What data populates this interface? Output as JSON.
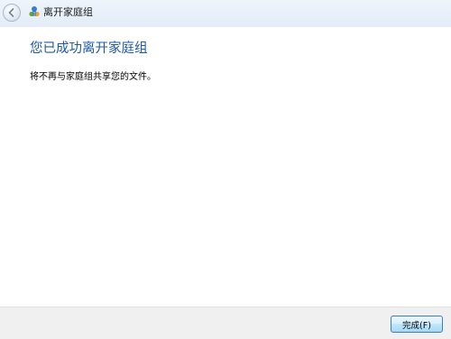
{
  "titlebar": {
    "title": "离开家庭组",
    "back_icon": "back-arrow-icon",
    "app_icon": "homegroup-icon"
  },
  "main": {
    "heading": "您已成功离开家庭组",
    "message": "将不再与家庭组共享您的文件。"
  },
  "footer": {
    "finish_label": "完成(F)"
  },
  "colors": {
    "heading": "#1d5aab",
    "titlebar": "#e3ecf7",
    "footer": "#f0f0f0",
    "button_border": "#3c7fb1"
  }
}
